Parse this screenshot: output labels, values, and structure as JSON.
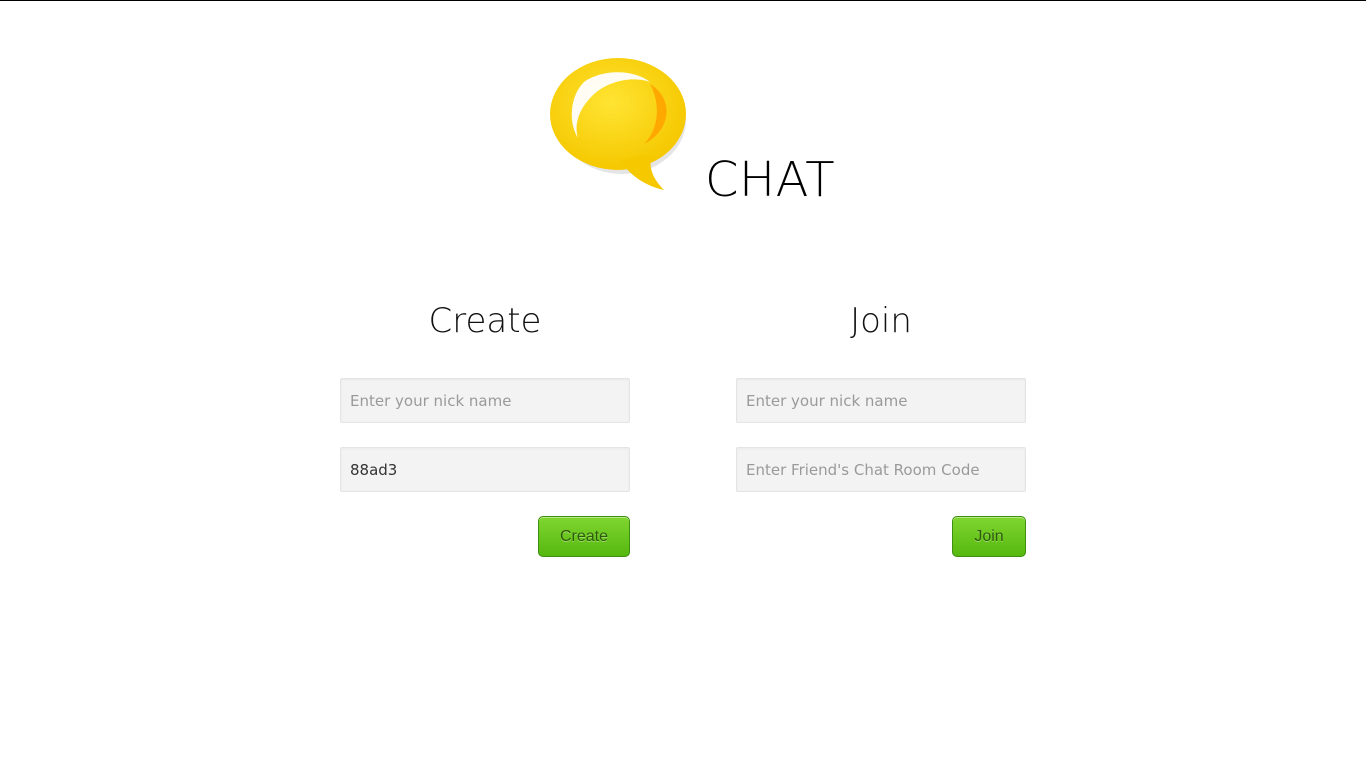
{
  "app": {
    "title": "CHAT"
  },
  "create": {
    "heading": "Create",
    "nickname_placeholder": "Enter your nick name",
    "nickname_value": "",
    "room_code_value": "88ad3",
    "button_label": "Create"
  },
  "join": {
    "heading": "Join",
    "nickname_placeholder": "Enter your nick name",
    "nickname_value": "",
    "room_code_placeholder": "Enter Friend's Chat Room Code",
    "room_code_value": "",
    "button_label": "Join"
  },
  "colors": {
    "logo_yellow": "#ffd400",
    "logo_orange": "#ffa800",
    "button_green": "#5bbf14"
  },
  "icons": {
    "logo": "speech-bubble-icon"
  }
}
